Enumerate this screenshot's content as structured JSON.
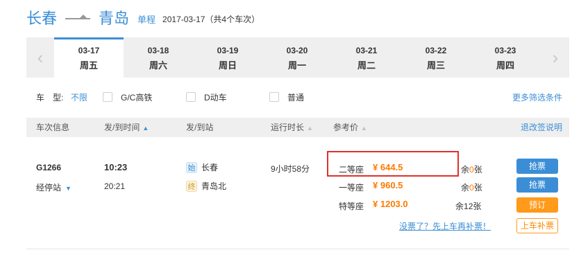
{
  "header": {
    "from_city": "长春",
    "to_city": "青岛",
    "trip_type": "单程",
    "trip_info": "2017-03-17（共4个车次）"
  },
  "datebar": {
    "prev_icon": "chevron-left-icon",
    "next_icon": "chevron-right-icon",
    "dates": [
      {
        "date": "03-17",
        "weekday": "周五",
        "active": true
      },
      {
        "date": "03-18",
        "weekday": "周六"
      },
      {
        "date": "03-19",
        "weekday": "周日"
      },
      {
        "date": "03-20",
        "weekday": "周一"
      },
      {
        "date": "03-21",
        "weekday": "周二"
      },
      {
        "date": "03-22",
        "weekday": "周三"
      },
      {
        "date": "03-23",
        "weekday": "周四"
      }
    ]
  },
  "filter": {
    "label": "车　型:",
    "all": "不限",
    "options": [
      "G/C高铁",
      "D动车",
      "普通"
    ],
    "more": "更多筛选条件"
  },
  "table_header": {
    "train_info": "车次信息",
    "dep_arr_time": "发/到时间",
    "dep_arr_station": "发/到站",
    "duration": "运行时长",
    "ref_price": "参考价",
    "refund": "退改签说明"
  },
  "train": {
    "number": "G1266",
    "stops_label": "经停站",
    "dep_time": "10:23",
    "arr_time": "20:21",
    "dep_tag": "始",
    "dep_station": "长春",
    "arr_tag": "终",
    "arr_station": "青岛北",
    "duration": "9小时58分",
    "seats": [
      {
        "name": "二等座",
        "currency": "¥",
        "price": "644.5",
        "remain_pre": "余",
        "remain_num": "0",
        "remain_post": "张",
        "button": "抢票"
      },
      {
        "name": "一等座",
        "currency": "¥",
        "price": "960.5",
        "remain_pre": "余",
        "remain_num": "0",
        "remain_post": "张",
        "button": "抢票"
      },
      {
        "name": "特等座",
        "currency": "¥",
        "price": "1203.0",
        "remain_pre": "余",
        "remain_num": "12",
        "remain_post": "张",
        "button": "预订"
      }
    ],
    "no_ticket_link": "没票了？先上车再补票！",
    "board_button": "上车补票"
  },
  "colors": {
    "accent": "#3b8ed6",
    "price": "#ff7a00",
    "highlight_box": "#e0302b",
    "book_button": "#ff9a1a"
  }
}
